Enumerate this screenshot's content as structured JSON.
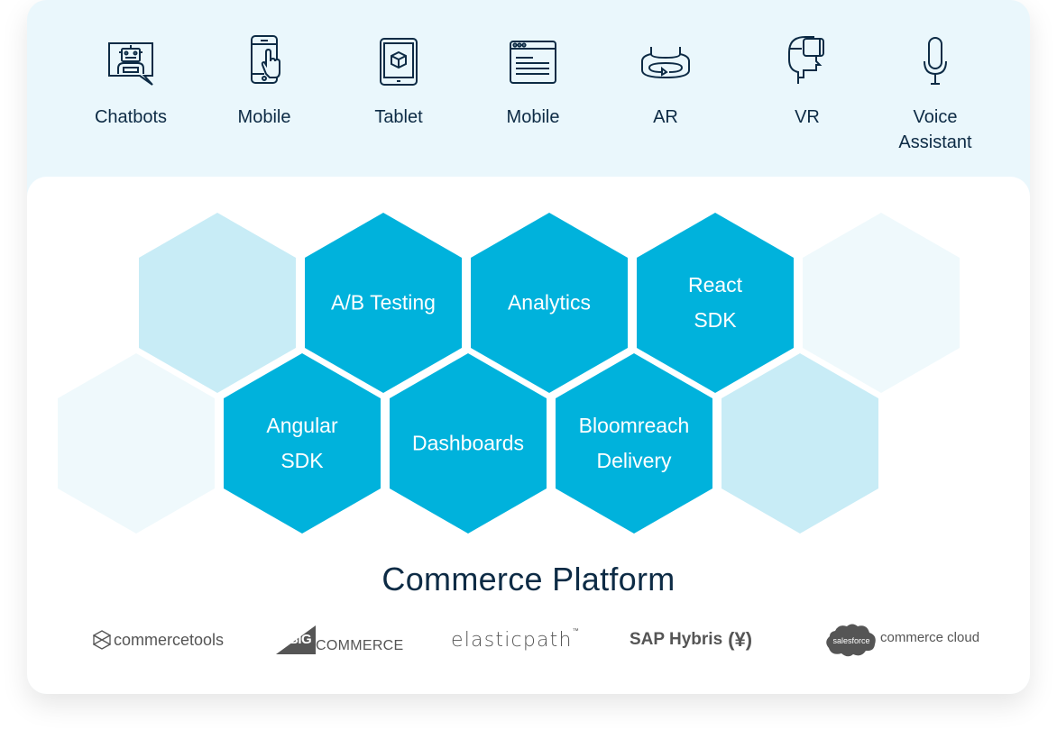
{
  "colors": {
    "primary_hex": "#00b2dc",
    "light_hex": "#c8ecf6",
    "faint_hex": "#eff9fc",
    "text_dark": "#0d2b45",
    "channel_bg": "#eaf7fc",
    "logo_gray": "#555555"
  },
  "channels": [
    {
      "label": "Chatbots",
      "icon": "chatbot-icon"
    },
    {
      "label": "Mobile",
      "icon": "mobile-touch-icon"
    },
    {
      "label": "Tablet",
      "icon": "tablet-icon"
    },
    {
      "label": "Mobile",
      "icon": "browser-window-icon"
    },
    {
      "label": "AR",
      "icon": "ar-icon"
    },
    {
      "label": "VR",
      "icon": "vr-headset-icon"
    },
    {
      "label": "Voice Assistant",
      "label_line1": "Voice",
      "label_line2": "Assistant",
      "icon": "microphone-icon"
    }
  ],
  "hexagons": [
    {
      "label_lines": [],
      "style": "light",
      "row": "top",
      "slot": 0
    },
    {
      "label_lines": [
        "A/B Testing"
      ],
      "style": "primary",
      "row": "top",
      "slot": 1
    },
    {
      "label_lines": [
        "Analytics"
      ],
      "style": "primary",
      "row": "top",
      "slot": 2
    },
    {
      "label_lines": [
        "React",
        "SDK"
      ],
      "style": "primary",
      "row": "top",
      "slot": 3
    },
    {
      "label_lines": [],
      "style": "faint",
      "row": "top",
      "slot": 4
    },
    {
      "label_lines": [],
      "style": "faint",
      "row": "bottom",
      "slot": 0
    },
    {
      "label_lines": [
        "Angular",
        "SDK"
      ],
      "style": "primary",
      "row": "bottom",
      "slot": 1
    },
    {
      "label_lines": [
        "Dashboards"
      ],
      "style": "primary",
      "row": "bottom",
      "slot": 2
    },
    {
      "label_lines": [
        "Bloomreach",
        "Delivery"
      ],
      "style": "primary",
      "row": "bottom",
      "slot": 3
    },
    {
      "label_lines": [],
      "style": "light",
      "row": "bottom",
      "slot": 4
    }
  ],
  "platform": {
    "title": "Commerce Platform",
    "logos": [
      {
        "name": "commercetools",
        "text": "commercetools"
      },
      {
        "name": "bigcommerce",
        "text_big": "BIG",
        "text_rest": "COMMERCE"
      },
      {
        "name": "elasticpath",
        "text": "elasticpath",
        "tm": "™"
      },
      {
        "name": "sap-hybris",
        "text": "SAP Hybris",
        "mark": "(¥)"
      },
      {
        "name": "salesforce-commerce-cloud",
        "cloud_text": "salesforce",
        "text": "commerce cloud"
      }
    ]
  }
}
